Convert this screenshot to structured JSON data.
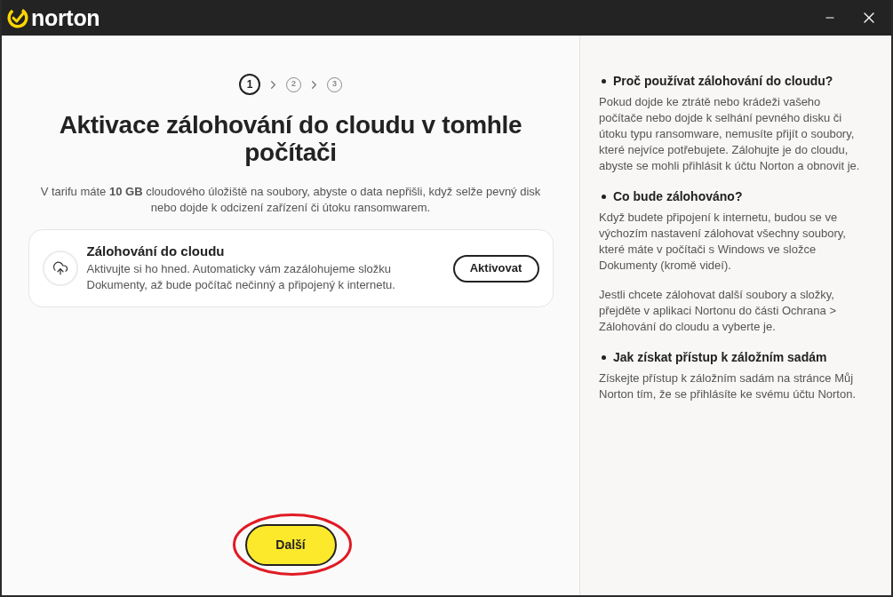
{
  "window": {
    "logo_text": "norton"
  },
  "stepper": {
    "steps": [
      {
        "label": "1",
        "selected": true
      },
      {
        "label": "2",
        "selected": false
      },
      {
        "label": "3",
        "selected": false
      }
    ]
  },
  "heading": "Aktivace zálohování do cloudu v tomhle počítači",
  "description": "V tarifu máte **10 GB** cloudového úložiště na soubory, abyste o data nepřišli, když selže pevný disk nebo dojde k odcizení zařízení či útoku ransomwarem.",
  "backup_card": {
    "title": "Zálohování do cloudu",
    "text": "Aktivujte si ho hned. Automaticky vám zazálohujeme složku Dokumenty, až bude počítač nečinný a připojený k internetu.",
    "button": "Aktivovat"
  },
  "next_button": {
    "label": "Další",
    "highlighted": true
  },
  "info_sections": [
    {
      "title": "Proč používat zálohování do cloudu?",
      "paragraphs": [
        "Pokud dojde ke ztrátě nebo krádeži vašeho počítače nebo dojde k selhání pevného disku či útoku typu ransomware, nemusíte přijít o soubory, které nejvíce potřebujete. Zálohujte je do cloudu, abyste se mohli přihlásit k účtu Norton a obnovit je."
      ]
    },
    {
      "title": "Co bude zálohováno?",
      "paragraphs": [
        "Když budete připojení k internetu, budou se ve výchozím nastavení zálohovat všechny soubory, které máte v počítači s Windows ve složce Dokumenty (kromě videí).",
        "Jestli chcete zálohovat další soubory a složky, přejděte v aplikaci Nortonu do části Ochrana > Zálohování do cloudu a vyberte je."
      ]
    },
    {
      "title": "Jak získat přístup k záložním sadám",
      "paragraphs": [
        "Získejte přístup k záložním sadám na stránce Můj Norton tím, že se přihlásíte ke svému účtu Norton."
      ]
    }
  ]
}
